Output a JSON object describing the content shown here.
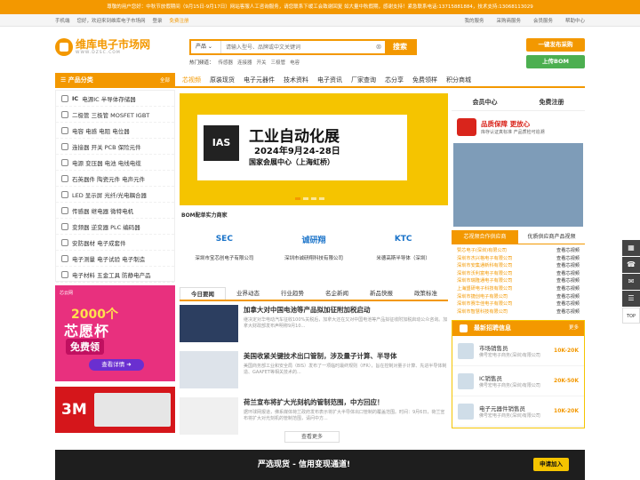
{
  "notice": "尊敬的用户您好：中秋节放假期间（9月15日-9月17日）网站客服人工咨询服务，请您联系下缓工会致谢回复 如大量中秋假期，感谢支持！紧急联系电话:13715881884，技术支持:13068113029",
  "topnav": {
    "mobile": "手机端",
    "welcome": "您好，欢迎来到维库电子市场网",
    "login": "登录",
    "register": "免费注册",
    "links": [
      "我的服务",
      "采购商服务",
      "会员服务",
      "帮助中心"
    ]
  },
  "logo": {
    "name": "维库电子市场网",
    "domain": "WWW.DZSC.COM"
  },
  "search": {
    "category": "产品",
    "placeholder": "请输入型号、品牌或中文关键词",
    "button": "搜索"
  },
  "hot": {
    "label": "热门频道：",
    "items": [
      "传感器",
      "连接器",
      "开关",
      "三极管",
      "电容"
    ]
  },
  "header_buttons": {
    "purchase": "一键发布采购",
    "upload_bom": "上传BOM"
  },
  "nav": {
    "category_title": "产品分类",
    "all": "全部",
    "items": [
      "芯视频",
      "原装现货",
      "电子元器件",
      "技术资料",
      "电子资讯",
      "厂家查询",
      "芯分享",
      "免费领样",
      "积分商城"
    ]
  },
  "categories": [
    {
      "bold": "IC",
      "rest": "电源IC  半导体存储器"
    },
    {
      "bold": "",
      "rest": "二极管  三极管  MOSFET  IGBT"
    },
    {
      "bold": "",
      "rest": "电容  电感  电阻  电位器"
    },
    {
      "bold": "",
      "rest": "连接器  开关  PCB  保险元件"
    },
    {
      "bold": "",
      "rest": "电源  变压器  电池  电线电缆"
    },
    {
      "bold": "",
      "rest": "石英器件  陶瓷元件  电声元件"
    },
    {
      "bold": "",
      "rest": "LED  显示屏  光纤/光电耦合器"
    },
    {
      "bold": "",
      "rest": "传感器  继电器  微特电机"
    },
    {
      "bold": "",
      "rest": "变频器  逆变器  PLC  编码器"
    },
    {
      "bold": "",
      "rest": "安防器材  电子成套件"
    },
    {
      "bold": "",
      "rest": "电子测量  电子试验  电子制造"
    },
    {
      "bold": "",
      "rest": "电子材料  五金工具  防静电产品"
    }
  ],
  "ad1": {
    "tag": "芯云网",
    "year": "2000个",
    "title": "芯愿杯",
    "free": "免费领",
    "see": "查看详情 ➜"
  },
  "ad2": {
    "brand": "3M"
  },
  "banner": {
    "logo": "IAS",
    "title": "工业自动化展",
    "date": "2024年9月24-28日",
    "venue": "国家会展中心（上海虹桥）"
  },
  "bom": {
    "label": "BOM配单实力商家",
    "companies": [
      {
        "logo": "SEC",
        "name": "深圳市宝芯创电子有限公司"
      },
      {
        "logo": "诚研翔",
        "name": "深圳市诚研翔科技有限公司"
      },
      {
        "logo": "KTC",
        "name": "米德高斯半导体（深圳）"
      }
    ]
  },
  "news": {
    "tabs": [
      "今日要闻",
      "业界动态",
      "行业趋势",
      "名企新闻",
      "新品快报",
      "政策标准"
    ],
    "items": [
      {
        "title": "加拿大对中国电池等产品拟加征附加税启动",
        "desc": "继决定对华电动汽车征收100%关税后，加拿大还在又对中国电池等产品拟征收附加税启动公众咨询。加拿大财政部发布声明称9月10..."
      },
      {
        "title": "美国收紧关键技术出口管制，涉及量子计算、半导体",
        "desc": "美国商务部工业和安全局（BIS）发布了一项临时最终规则（IFR），旨在控制对量子计算、先进半导体制造、GAAFET等相关技术的..."
      },
      {
        "title": "荷兰宣布将扩大光刻机的管制范围，中方回应！",
        "desc": "据环球网报道，佛系媒体荷兰政府发布表示将扩大半导体出口管制的覆盖范围。时间：9月6日，荷兰宣布将扩大对光刻机的管制范围，请问中方..."
      }
    ],
    "more": "查看更多"
  },
  "right": {
    "tabs": [
      "会员中心",
      "免费注册"
    ],
    "quality": "品质保障 更放心",
    "quality_sub": "库存认证真标准 产品质检可追溯",
    "tabs2": [
      "芯视频合作供应商",
      "优质供应商产品视频"
    ],
    "suppliers": [
      {
        "name": "赞芯电子(深圳)有限公司",
        "link": "查看芯视频"
      },
      {
        "name": "深圳市杰兴格电子有限公司",
        "link": "查看芯视频"
      },
      {
        "name": "深圳市安集通新科有限公司",
        "link": "查看芯视频"
      },
      {
        "name": "深圳市沃利富电子有限公司",
        "link": "查看芯视频"
      },
      {
        "name": "深圳市瑞隆通电子有限公司",
        "link": "查看芯视频"
      },
      {
        "name": "上海盟研电子科技有限公司",
        "link": "查看芯视频"
      },
      {
        "name": "深圳市捷创电子有限公司",
        "link": "查看芯视频"
      },
      {
        "name": "深圳市赛华佳电子有限公司",
        "link": "查看芯视频"
      },
      {
        "name": "深圳市智慧科技有限公司",
        "link": "查看芯视频"
      }
    ],
    "jobs_title": "最新招聘信息",
    "jobs_more": "更多",
    "jobs": [
      {
        "title": "市场销售员",
        "company": "佛号宏电子商务(深圳)有限公司",
        "salary": "10K-20K"
      },
      {
        "title": "IC销售员",
        "company": "佛号宏电子商务(深圳)有限公司",
        "salary": "20K-50K"
      },
      {
        "title": "电子元器件销售员",
        "company": "佛号宏电子商务(深圳)有限公司",
        "salary": "10K-20K"
      }
    ]
  },
  "bottom": {
    "slogan": "严选现货 - 信用变现通道!",
    "apply": "申请加入"
  },
  "float": [
    "▦",
    "☎",
    "✉",
    "☰",
    "TOP"
  ]
}
